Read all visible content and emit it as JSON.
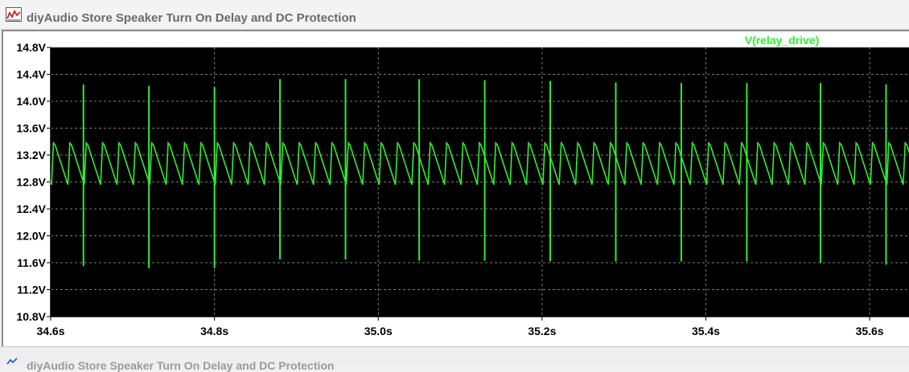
{
  "window": {
    "title": "diyAudio Store Speaker Turn On Delay and DC Protection",
    "icon": "waveform-viewer-icon"
  },
  "second_window": {
    "title": "diyAudio Store Speaker Turn On Delay and DC Protection",
    "icon": "waveform-viewer-icon"
  },
  "colors": {
    "plot_background": "#000000",
    "trace": "#2df02d",
    "grid": "#7a7a7a",
    "axis_text": "#000000"
  },
  "chart_data": {
    "type": "line",
    "title": "",
    "xlabel": "",
    "ylabel": "",
    "xlim": [
      34.6,
      35.65
    ],
    "ylim": [
      10.8,
      14.8
    ],
    "xticks": [
      34.6,
      34.8,
      35.0,
      35.2,
      35.4,
      35.6
    ],
    "xtick_labels": [
      "34.6s",
      "34.8s",
      "35.0s",
      "35.2s",
      "35.4s",
      "35.6s"
    ],
    "yticks": [
      10.8,
      11.2,
      11.6,
      12.0,
      12.4,
      12.8,
      13.2,
      13.6,
      14.0,
      14.4,
      14.8
    ],
    "ytick_labels": [
      "10.8V",
      "11.2V",
      "11.6V",
      "12.0V",
      "12.4V",
      "12.8V",
      "13.2V",
      "13.6V",
      "14.0V",
      "14.4V",
      "14.8V"
    ],
    "grid": true,
    "legend_position": "top-right",
    "series": [
      {
        "name": "V(relay_drive)",
        "ripple": {
          "start_s": 34.601,
          "period_s": 0.02,
          "peak_v": 13.38,
          "trough_v": 12.76
        },
        "spikes": [
          {
            "t": 34.64,
            "high_v": 14.25,
            "low_v": 11.55
          },
          {
            "t": 34.72,
            "high_v": 14.23,
            "low_v": 11.52
          },
          {
            "t": 34.8,
            "high_v": 14.21,
            "low_v": 11.52
          },
          {
            "t": 34.88,
            "high_v": 14.33,
            "low_v": 11.65
          },
          {
            "t": 34.96,
            "high_v": 14.33,
            "low_v": 11.65
          },
          {
            "t": 35.05,
            "high_v": 14.33,
            "low_v": 11.63
          },
          {
            "t": 35.13,
            "high_v": 14.31,
            "low_v": 11.63
          },
          {
            "t": 35.21,
            "high_v": 14.3,
            "low_v": 11.62
          },
          {
            "t": 35.29,
            "high_v": 14.28,
            "low_v": 11.62
          },
          {
            "t": 35.37,
            "high_v": 14.27,
            "low_v": 11.62
          },
          {
            "t": 35.45,
            "high_v": 14.27,
            "low_v": 11.62
          },
          {
            "t": 35.54,
            "high_v": 14.27,
            "low_v": 11.6
          },
          {
            "t": 35.62,
            "high_v": 14.25,
            "low_v": 11.57
          }
        ]
      }
    ]
  }
}
